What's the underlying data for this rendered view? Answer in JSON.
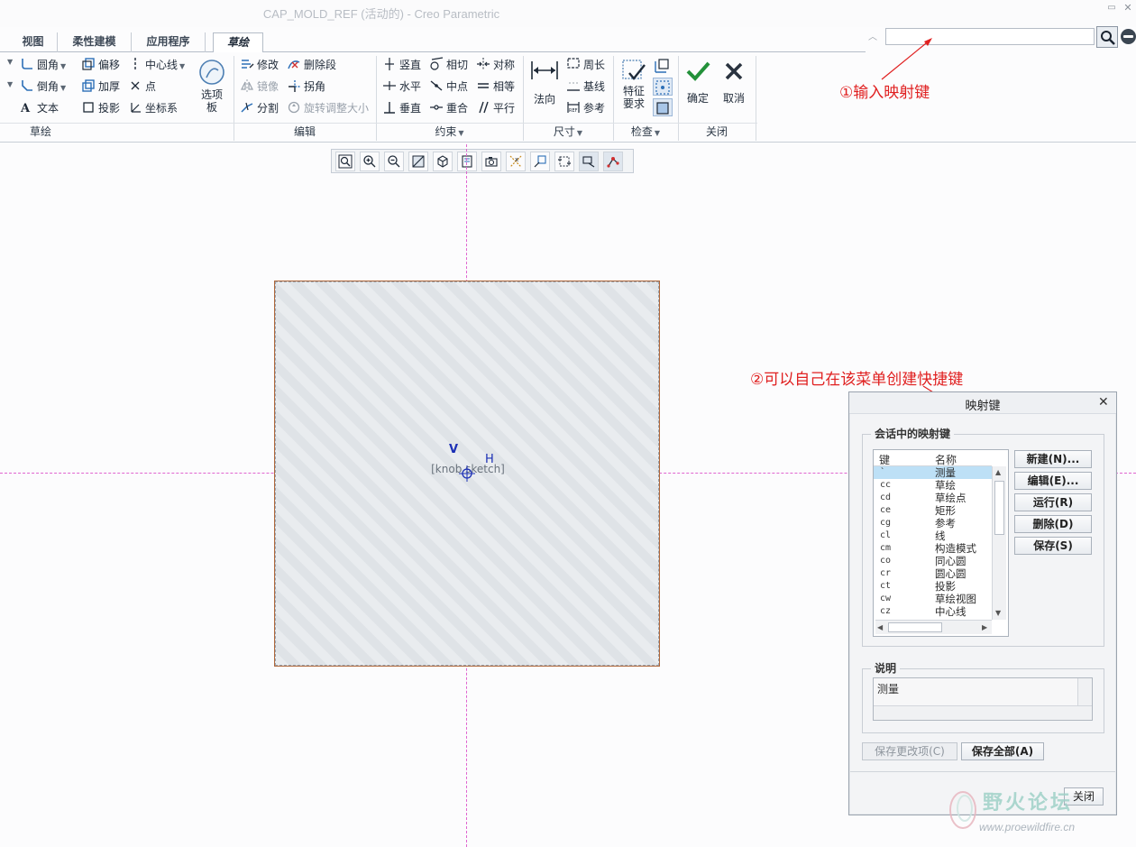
{
  "window": {
    "title": "CAP_MOLD_REF (活动的) - Creo Parametric"
  },
  "tabs": [
    {
      "label": "视图"
    },
    {
      "label": "柔性建模"
    },
    {
      "label": "应用程序"
    },
    {
      "label": "草绘"
    }
  ],
  "ribbon": {
    "sketch_group": {
      "label": "草绘",
      "fillet": "圆角",
      "chamfer": "倒角",
      "text": "文本",
      "offset": "偏移",
      "thicken": "加厚",
      "project": "投影",
      "centerline": "中心线",
      "point": "点",
      "coordsys": "坐标系",
      "palette_line1": "选项",
      "palette_line2": "板"
    },
    "edit_group": {
      "label": "编辑",
      "modify": "修改",
      "mirror": "镜像",
      "divide": "分割",
      "delete_segment": "删除段",
      "corner": "拐角",
      "rotate_resize": "旋转调整大小"
    },
    "constrain_group": {
      "label": "约束",
      "vertical": "竖直",
      "horizontal": "水平",
      "perpendicular": "垂直",
      "tangent": "相切",
      "midpoint": "中点",
      "coincident": "重合",
      "symmetric": "对称",
      "equal": "相等",
      "parallel": "平行"
    },
    "dimension_group": {
      "label": "尺寸",
      "normal": "法向",
      "perimeter": "周长",
      "baseline": "基线",
      "reference": "参考"
    },
    "inspect_group": {
      "label": "检查",
      "feature_req_line1": "特征",
      "feature_req_line2": "要求"
    },
    "close_group": {
      "label": "关闭",
      "ok": "确定",
      "cancel": "取消"
    }
  },
  "canvas": {
    "placeholder": "[knob sketch]",
    "label_v": "V",
    "label_h": "H"
  },
  "annotations": {
    "step1": "①输入映射键",
    "step2": "②可以自己在该菜单创建快捷键"
  },
  "mapkey_dialog": {
    "title": "映射键",
    "session_legend": "会话中的映射键",
    "col_key": "键",
    "col_name": "名称",
    "rows": [
      {
        "key": "`",
        "name": "测量"
      },
      {
        "key": "cc",
        "name": "草绘"
      },
      {
        "key": "cd",
        "name": "草绘点"
      },
      {
        "key": "ce",
        "name": "矩形"
      },
      {
        "key": "cg",
        "name": "参考"
      },
      {
        "key": "cl",
        "name": "线"
      },
      {
        "key": "cm",
        "name": "构造模式"
      },
      {
        "key": "co",
        "name": "同心圆"
      },
      {
        "key": "cr",
        "name": "圆心圆"
      },
      {
        "key": "ct",
        "name": "投影"
      },
      {
        "key": "cw",
        "name": "草绘视图"
      },
      {
        "key": "cz",
        "name": "中心线"
      }
    ],
    "btn_new": "新建(N)...",
    "btn_edit": "编辑(E)...",
    "btn_run": "运行(R)",
    "btn_delete": "删除(D)",
    "btn_save": "保存(S)",
    "desc_legend": "说明",
    "desc_text": "测量",
    "btn_save_changed": "保存更改项(C)",
    "btn_save_all": "保存全部(A)",
    "btn_close": "关闭"
  },
  "watermark": {
    "name": "野火论坛",
    "url": "www.proewildfire.cn"
  }
}
